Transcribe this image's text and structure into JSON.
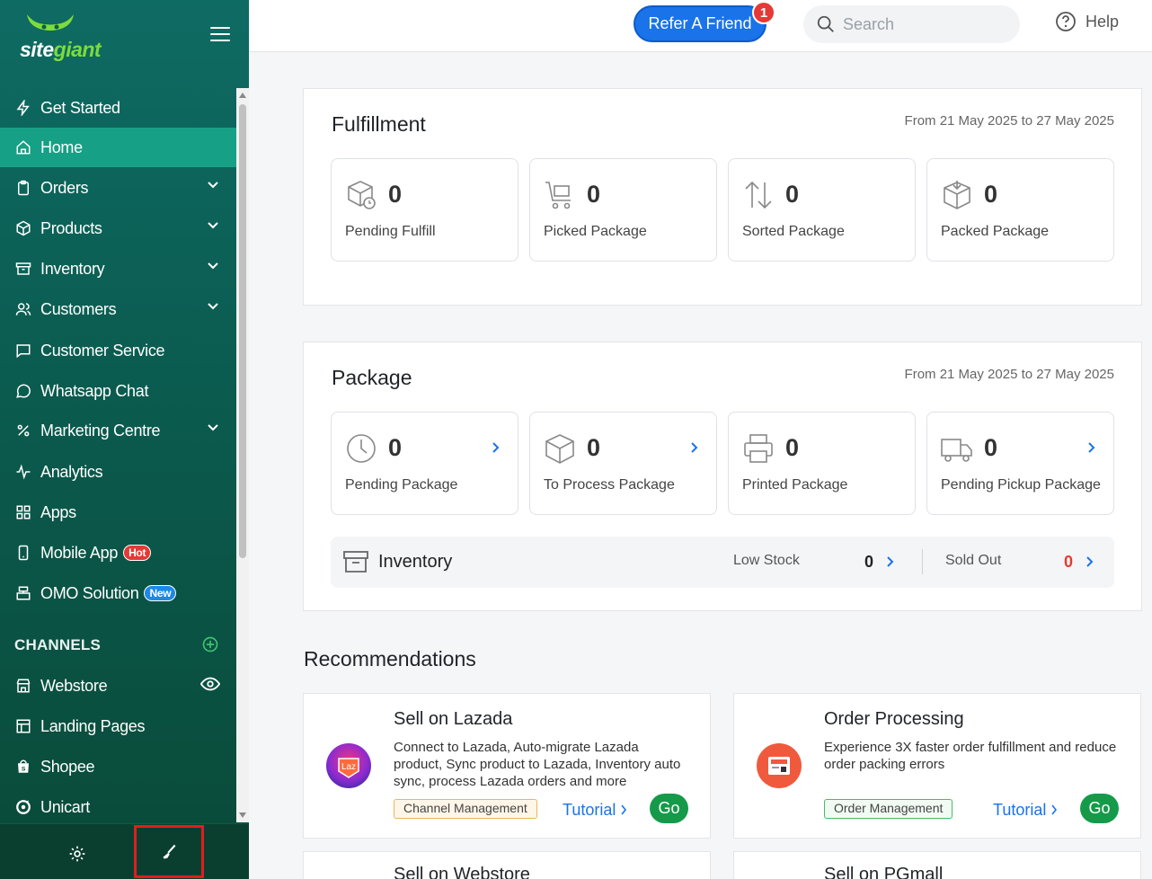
{
  "brand": {
    "logo_site": "site",
    "logo_giant": "giant"
  },
  "sidebar": {
    "items": [
      {
        "label": "Get Started",
        "icon": "bolt-icon"
      },
      {
        "label": "Home",
        "icon": "home-icon"
      },
      {
        "label": "Orders",
        "icon": "clipboard-icon"
      },
      {
        "label": "Products",
        "icon": "cube-icon"
      },
      {
        "label": "Inventory",
        "icon": "archive-icon"
      },
      {
        "label": "Customers",
        "icon": "users-icon"
      },
      {
        "label": "Customer Service",
        "icon": "chat-icon"
      },
      {
        "label": "Whatsapp Chat",
        "icon": "whatsapp-icon"
      },
      {
        "label": "Marketing Centre",
        "icon": "percent-icon"
      },
      {
        "label": "Analytics",
        "icon": "pulse-icon"
      },
      {
        "label": "Apps",
        "icon": "grid-icon"
      },
      {
        "label": "Mobile App",
        "icon": "phone-icon",
        "badge": "Hot"
      },
      {
        "label": "OMO Solution",
        "icon": "register-icon",
        "badge": "New"
      }
    ],
    "channels_title": "CHANNELS",
    "channels": [
      {
        "label": "Webstore",
        "icon": "store-icon"
      },
      {
        "label": "Landing Pages",
        "icon": "pages-icon"
      },
      {
        "label": "Shopee",
        "icon": "shopee-icon"
      },
      {
        "label": "Unicart",
        "icon": "unicart-icon"
      }
    ]
  },
  "header": {
    "refer_label": "Refer A Friend",
    "refer_badge": "1",
    "search_placeholder": "Search",
    "help_label": "Help"
  },
  "fulfillment": {
    "title": "Fulfillment",
    "date_range": "From 21 May 2025 to 27 May 2025",
    "stats": [
      {
        "value": "0",
        "label": "Pending Fulfill"
      },
      {
        "value": "0",
        "label": "Picked Package"
      },
      {
        "value": "0",
        "label": "Sorted Package"
      },
      {
        "value": "0",
        "label": "Packed Package"
      }
    ]
  },
  "package": {
    "title": "Package",
    "date_range": "From 21 May 2025 to 27 May 2025",
    "stats": [
      {
        "value": "0",
        "label": "Pending Package"
      },
      {
        "value": "0",
        "label": "To Process Package"
      },
      {
        "value": "0",
        "label": "Printed Package"
      },
      {
        "value": "0",
        "label": "Pending Pickup Package"
      }
    ],
    "inventory": {
      "title": "Inventory",
      "low_stock_label": "Low Stock",
      "low_stock_value": "0",
      "sold_out_label": "Sold Out",
      "sold_out_value": "0"
    }
  },
  "recommendations": {
    "title": "Recommendations",
    "cards": [
      {
        "name": "Sell on Lazada",
        "desc": "Connect to Lazada, Auto-migrate Lazada product, Sync product to Lazada, Inventory auto sync, process Lazada orders and more",
        "tag": "Channel Management",
        "tutorial": "Tutorial",
        "go": "Go",
        "logo_text": "Laz"
      },
      {
        "name": "Order Processing",
        "desc": "Experience 3X faster order fulfillment and reduce order packing errors",
        "tag": "Order Management",
        "tutorial": "Tutorial",
        "go": "Go"
      },
      {
        "name": "Sell on Webstore"
      },
      {
        "name": "Sell on PGmall"
      }
    ]
  },
  "colors": {
    "sidebar": "#0b5b4f",
    "active": "#16a085",
    "accent": "#1a73e8",
    "go": "#159a4a",
    "danger": "#e53935"
  }
}
